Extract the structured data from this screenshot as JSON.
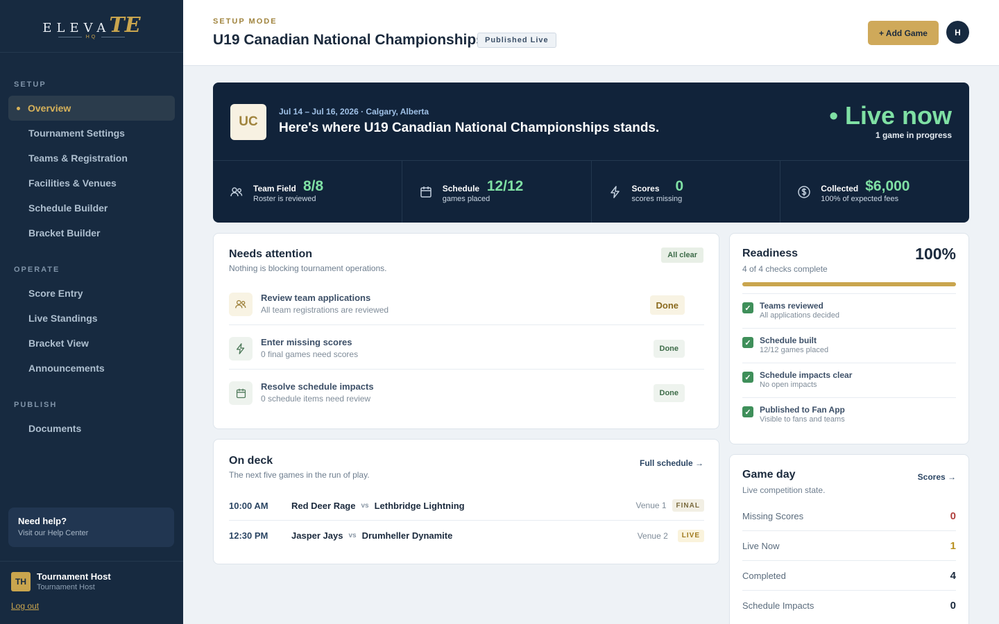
{
  "brand": {
    "logo_main": "ELEVA",
    "logo_accent": "TE",
    "logo_sub": "HQ"
  },
  "sidebar": {
    "sections": [
      {
        "title": "SETUP",
        "items": [
          "Overview",
          "Tournament Settings",
          "Teams & Registration",
          "Facilities & Venues",
          "Schedule Builder",
          "Bracket Builder"
        ]
      },
      {
        "title": "OPERATE",
        "items": [
          "Score Entry",
          "Live Standings",
          "Bracket View",
          "Announcements"
        ]
      },
      {
        "title": "PUBLISH",
        "items": [
          "Documents"
        ]
      }
    ],
    "active": "Overview",
    "help": {
      "title": "Need help?",
      "subtitle": "Visit our Help Center"
    },
    "user": {
      "initials": "TH",
      "name": "Tournament Host",
      "role": "Tournament Host",
      "logout": "Log out"
    }
  },
  "header": {
    "mode": "SETUP MODE",
    "title": "U19 Canadian National Championships",
    "badge": "Published Live",
    "add_game": "+ Add Game",
    "avatar": "H"
  },
  "hero": {
    "initials": "UC",
    "date_location": "Jul 14 – Jul 16, 2026 · Calgary, Alberta",
    "message": "Here's where U19 Canadian National Championships stands.",
    "live": "• Live now",
    "live_sub": "1 game in progress",
    "stats": [
      {
        "icon": "users-icon",
        "label": "Team Field",
        "value": "8/8",
        "sub": "Roster is reviewed"
      },
      {
        "icon": "calendar-icon",
        "label": "Schedule",
        "value": "12/12",
        "sub": "games placed"
      },
      {
        "icon": "bolt-icon",
        "label": "Scores",
        "value": "0",
        "sub": "scores missing"
      },
      {
        "icon": "dollar-icon",
        "label": "Collected",
        "value": "$6,000",
        "sub": "100% of expected fees"
      }
    ]
  },
  "attention": {
    "title": "Needs attention",
    "subtitle": "Nothing is blocking tournament operations.",
    "badge": "All clear",
    "items": [
      {
        "icon": "users-icon",
        "title": "Review team applications",
        "sub": "All team registrations are reviewed",
        "status": "Done"
      },
      {
        "icon": "bolt-icon",
        "title": "Enter missing scores",
        "sub": "0 final games need scores",
        "status": "Done"
      },
      {
        "icon": "calendar-icon",
        "title": "Resolve schedule impacts",
        "sub": "0 schedule items need review",
        "status": "Done"
      }
    ]
  },
  "ondeck": {
    "title": "On deck",
    "subtitle": "The next five games in the run of play.",
    "link": "Full schedule →",
    "games": [
      {
        "time": "10:00 AM",
        "home": "Red Deer Rage",
        "vs": "vs",
        "away": "Lethbridge Lightning",
        "venue": "Venue 1",
        "status": "FINAL"
      },
      {
        "time": "12:30 PM",
        "home": "Jasper Jays",
        "vs": "vs",
        "away": "Drumheller Dynamite",
        "venue": "Venue 2",
        "status": "LIVE"
      }
    ]
  },
  "readiness": {
    "title": "Readiness",
    "subtitle": "4 of 4 checks complete",
    "percent": "100%",
    "progress": 1.0,
    "checks": [
      {
        "title": "Teams reviewed",
        "sub": "All applications decided"
      },
      {
        "title": "Schedule built",
        "sub": "12/12 games placed"
      },
      {
        "title": "Schedule impacts clear",
        "sub": "No open impacts"
      },
      {
        "title": "Published to Fan App",
        "sub": "Visible to fans and teams"
      }
    ]
  },
  "gameday": {
    "title": "Game day",
    "subtitle": "Live competition state.",
    "link": "Scores →",
    "rows": [
      {
        "label": "Missing Scores",
        "value": "0",
        "color": "#b0413e"
      },
      {
        "label": "Live Now",
        "value": "1",
        "color": "#b8901f"
      },
      {
        "label": "Completed",
        "value": "4",
        "color": "#1b2a3d"
      },
      {
        "label": "Schedule Impacts",
        "value": "0",
        "color": "#1b2a3d"
      }
    ]
  },
  "colors": {
    "accent": "#c9a54e",
    "navy": "#172a40",
    "live_green": "#7fe0a4"
  }
}
